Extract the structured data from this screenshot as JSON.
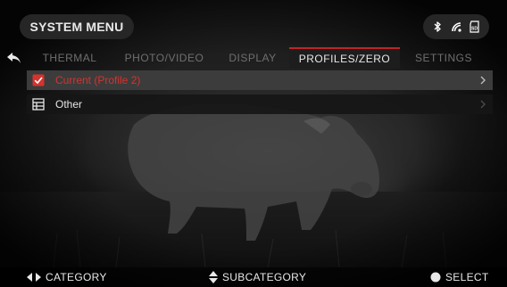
{
  "header": {
    "title": "SYSTEM MENU",
    "status_icons": [
      "bluetooth-icon",
      "wifi-icon",
      "sd-card-icon"
    ],
    "sd_label": "SD"
  },
  "tabs": [
    {
      "label": "THERMAL",
      "active": false
    },
    {
      "label": "PHOTO/VIDEO",
      "active": false
    },
    {
      "label": "DISPLAY",
      "active": false
    },
    {
      "label": "PROFILES/ZERO",
      "active": true
    },
    {
      "label": "SETTINGS",
      "active": false
    }
  ],
  "list": [
    {
      "label": "Current (Profile 2)",
      "icon": "checkbox-checked-icon",
      "selected": true
    },
    {
      "label": "Other",
      "icon": "table-list-icon",
      "selected": false
    }
  ],
  "footer": {
    "category": "CATEGORY",
    "subcategory": "SUBCATEGORY",
    "select": "SELECT"
  },
  "colors": {
    "accent": "#c0242a",
    "selected_text": "#d6332e",
    "inactive_tab": "#6f6f6f"
  }
}
